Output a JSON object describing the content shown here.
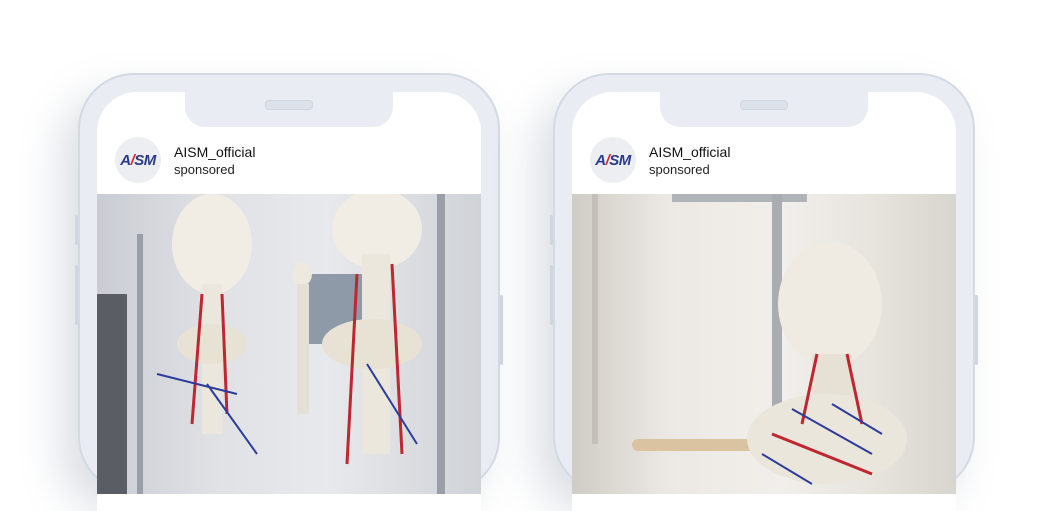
{
  "posts": [
    {
      "account": "AISM_official",
      "subtitle": "sponsored",
      "logo_text": "AISM",
      "photo": "skeleton-models-with-muscle-bands-in-studio"
    },
    {
      "account": "AISM_official",
      "subtitle": "sponsored",
      "logo_text": "AISM",
      "photo": "skeleton-head-and-neck-close-up-with-curtains"
    }
  ],
  "colors": {
    "logo_blue": "#2b3a8c",
    "logo_red": "#d8262f"
  }
}
